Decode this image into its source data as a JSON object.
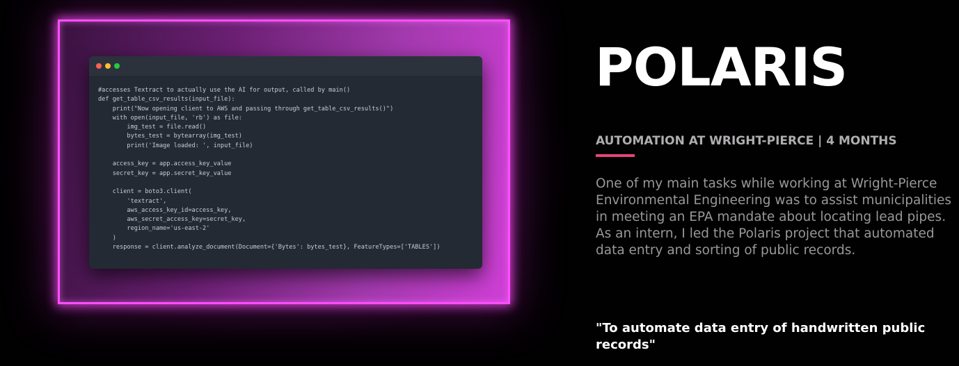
{
  "project": {
    "title": "POLARIS",
    "subtitle": "AUTOMATION AT WRIGHT-PIERCE | 4 MONTHS",
    "description": "One of my main tasks while working at Wright-Pierce Environmental Engineering was to assist municipalities in meeting an EPA mandate about locating lead pipes. As an intern, I led the Polaris project that automated data entry and sorting of public records.",
    "quote": "\"To automate data entry of handwritten public records\""
  },
  "colors": {
    "accent": "#e8437d",
    "frame_glow": "#ff4dff",
    "background": "#020102"
  },
  "code_window": {
    "lines": [
      "#accesses Textract to actually use the AI for output, called by main()",
      "def get_table_csv_results(input_file):",
      "    print(\"Now opening client to AWS and passing through get_table_csv_results()\")",
      "    with open(input_file, 'rb') as file:",
      "        img_test = file.read()",
      "        bytes_test = bytearray(img_test)",
      "        print('Image loaded: ', input_file)",
      "",
      "    access_key = app.access_key_value",
      "    secret_key = app.secret_key_value",
      "",
      "    client = boto3.client(",
      "        'textract',",
      "        aws_access_key_id=access_key,",
      "        aws_secret_access_key=secret_key,",
      "        region_name='us-east-2'",
      "    )",
      "    response = client.analyze_document(Document={'Bytes': bytes_test}, FeatureTypes=['TABLES'])"
    ]
  }
}
